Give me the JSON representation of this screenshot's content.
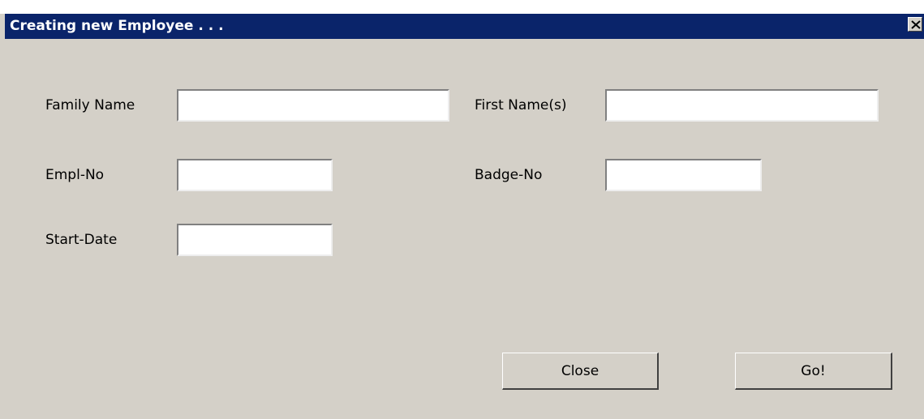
{
  "window": {
    "title": "Creating new Employee . . .",
    "colors": {
      "titlebar": "#0a246a",
      "face": "#d4d0c8",
      "title_text": "#ffffff"
    },
    "close_icon": "close-x-icon"
  },
  "form": {
    "family_name": {
      "label": "Family Name",
      "value": ""
    },
    "first_name": {
      "label": "First Name(s)",
      "value": ""
    },
    "empl_no": {
      "label": "Empl-No",
      "value": ""
    },
    "badge_no": {
      "label": "Badge-No",
      "value": ""
    },
    "start_date": {
      "label": "Start-Date",
      "value": ""
    }
  },
  "buttons": {
    "close": "Close",
    "go": "Go!"
  }
}
